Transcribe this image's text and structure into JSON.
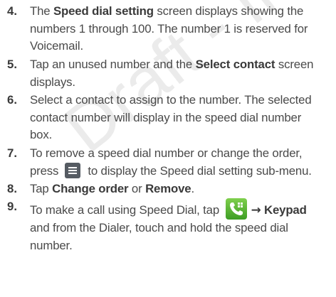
{
  "watermark": "Proprietary - Do Not Distribute, For Internal Use Only",
  "steps": [
    {
      "number": "4.",
      "l1a": "The ",
      "l1b": "Speed dial setting",
      "l1c": " screen displays showing the",
      "l2": "numbers 1 through 100. The number 1 is reserved for",
      "l3": "Voicemail."
    },
    {
      "number": "5.",
      "l1a": "Tap an unused number and the ",
      "l1b": "Select contact",
      "l1c": " screen",
      "l2": "displays."
    },
    {
      "number": "6.",
      "l1": "Select a contact to assign to the number. The selected",
      "l2": "contact number will display in the speed dial number",
      "l3": "box."
    },
    {
      "number": "7.",
      "l1": "To remove a speed dial number or change the order,",
      "l2a": "press ",
      "l2b": " to display the Speed dial setting sub-menu.",
      "icon": "menu-key-icon"
    },
    {
      "number": "8.",
      "l1a": "Tap ",
      "l1b": "Change order",
      "l1c": " or ",
      "l1d": "Remove",
      "l1e": "."
    },
    {
      "number": "9.",
      "l1a": "To make a call using Speed Dial, tap ",
      "l1arrow": "→",
      "l1b": "Keypad",
      "l2": "and from the Dialer, touch and hold the speed dial",
      "l3": "number.",
      "icon": "phone-app-icon"
    }
  ]
}
